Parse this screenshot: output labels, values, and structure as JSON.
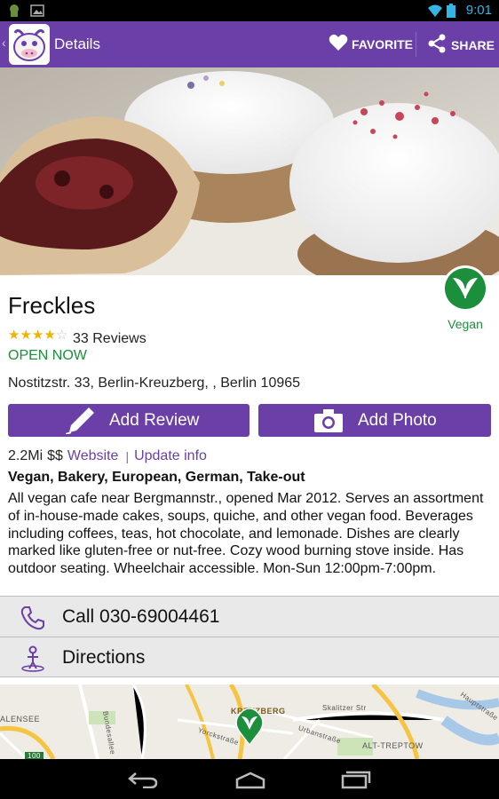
{
  "status_bar": {
    "time": "9:01"
  },
  "action_bar": {
    "back_glyph": "‹",
    "title": "Details",
    "favorite_label": "FAVORITE",
    "share_label": "SHARE"
  },
  "restaurant": {
    "name": "Freckles",
    "rating": 4,
    "rating_max": 5,
    "reviews_text": "33 Reviews",
    "open_status": "OPEN NOW",
    "address": "Nostitzstr. 33, Berlin-Kreuzberg, , Berlin 10965",
    "badge_label": "Vegan",
    "distance": "2.2Mi",
    "price": "$$",
    "website_label": "Website",
    "update_label": "Update info",
    "categories": "Vegan, Bakery, European, German, Take-out",
    "description": "All vegan cafe near Bergmannstr., opened Mar 2012. Serves an assortment of in-house-made cakes, soups, quiche, and other vegan food. Beverages including coffees, teas, hot chocolate, and lemonade. Dishes are clearly marked like gluten-free or nut-free. Cozy wood burning stove inside. Has outdoor seating. Wheelchair accessible. Mon-Sun 12:00pm-7:00pm."
  },
  "buttons": {
    "add_review": "Add Review",
    "add_photo": "Add Photo"
  },
  "actions": {
    "call": "Call 030-69004461",
    "directions": "Directions"
  },
  "map": {
    "labels": [
      "KREUZBERG",
      "ALENSEE",
      "ALT-TREPTOW",
      "Skalitzer Str",
      "Hauptstraße",
      "Urbanstraße",
      "Yorckstraße",
      "Bundesallee",
      "100"
    ]
  },
  "colors": {
    "brand_purple": "#6b3fa8",
    "vegan_green": "#1c8f3c",
    "star_gold": "#f0b400"
  },
  "icons": [
    "android-icon",
    "image-icon",
    "wifi-icon",
    "battery-icon",
    "heart-icon",
    "share-icon",
    "pen-icon",
    "camera-icon",
    "phone-icon",
    "person-icon",
    "leaf-icon",
    "map-pin-icon",
    "back-nav-icon",
    "home-nav-icon",
    "recents-nav-icon"
  ]
}
